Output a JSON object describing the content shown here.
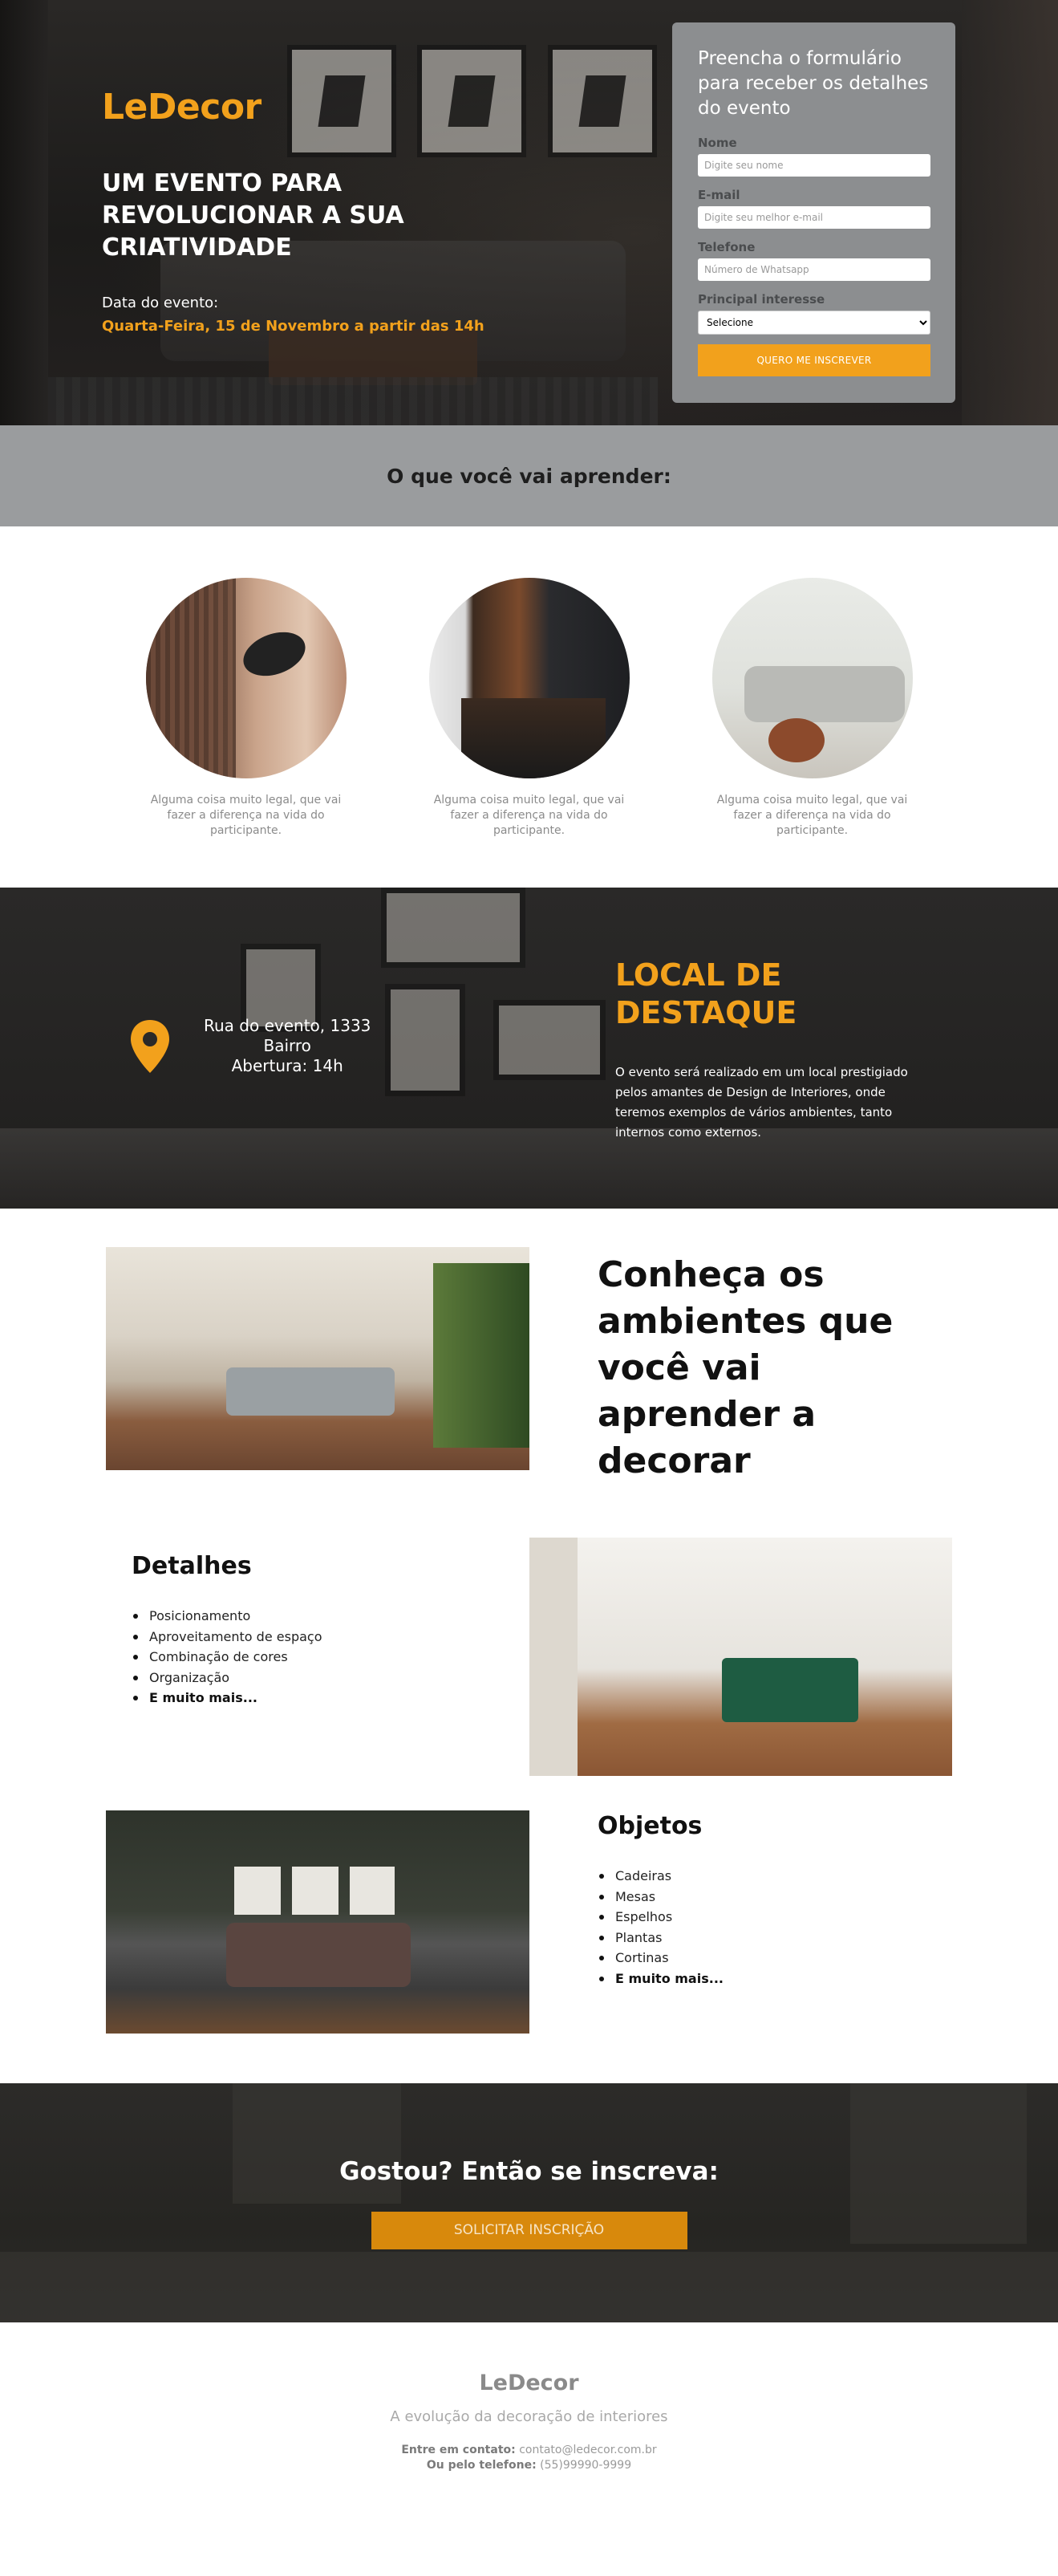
{
  "brand": {
    "logo": "LeDecor",
    "accent_color": "#f2a11c"
  },
  "hero": {
    "title": "UM EVENTO PARA REVOLUCIONAR A SUA CRIATIVIDADE",
    "event_label": "Data do evento:",
    "event_date": "Quarta-Feira, 15 de Novembro a partir das 14h"
  },
  "form": {
    "title": "Preencha o formulário para receber os detalhes do evento",
    "name_label": "Nome",
    "name_placeholder": "Digite seu nome",
    "email_label": "E-mail",
    "email_placeholder": "Digite seu melhor e-mail",
    "phone_label": "Telefone",
    "phone_placeholder": "Número de Whatsapp",
    "interest_label": "Principal interesse",
    "interest_selected": "Selecione",
    "submit_label": "QUERO ME INSCREVER"
  },
  "learn": {
    "title": "O que você vai aprender:",
    "items": [
      {
        "text": "Alguma coisa muito legal, que vai fazer a diferença na vida do participante."
      },
      {
        "text": "Alguma coisa muito legal, que vai fazer a diferença na vida do participante."
      },
      {
        "text": "Alguma coisa muito legal, que vai fazer a diferença na vida do participante."
      }
    ]
  },
  "location": {
    "icon": "map-pin-icon",
    "address_line1": "Rua do evento, 1333",
    "address_line2": "Bairro",
    "address_line3": "Abertura: 14h",
    "title": "LOCAL DE DESTAQUE",
    "description": "O evento será realizado em um local prestigiado pelos amantes de Design de Interiores, onde teremos exemplos de vários ambientes, tanto internos como externos."
  },
  "ambientes": {
    "title": "Conheça os ambientes que você vai aprender a decorar"
  },
  "detalhes": {
    "title": "Detalhes",
    "items": [
      "Posicionamento",
      "Aproveitamento de espaço",
      "Combinação de cores",
      "Organização"
    ],
    "more": "E muito mais..."
  },
  "objetos": {
    "title": "Objetos",
    "items": [
      "Cadeiras",
      "Mesas",
      "Espelhos",
      "Plantas",
      "Cortinas"
    ],
    "more": "E muito mais..."
  },
  "cta": {
    "title": "Gostou? Então se inscreva:",
    "button_label": "SOLICITAR INSCRIÇÃO"
  },
  "footer": {
    "logo": "LeDecor",
    "tagline": "A evolução da decoração de interiores",
    "contact_label": "Entre em contato:",
    "contact_email": "contato@ledecor.com.br",
    "phone_label": "Ou pelo telefone:",
    "phone": "(55)99990-9999"
  }
}
